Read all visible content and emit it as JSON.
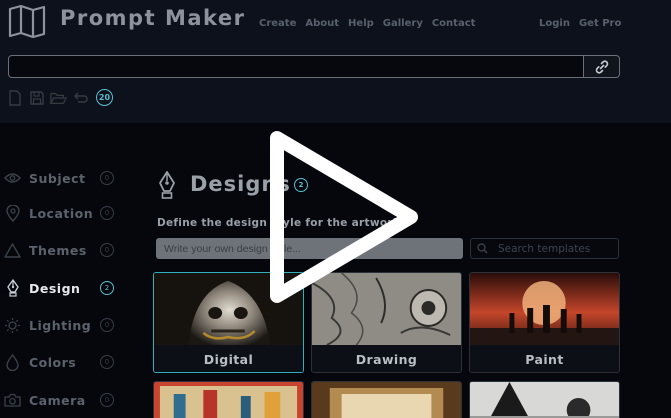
{
  "app": {
    "title": "Prompt Maker"
  },
  "nav": {
    "left": [
      "Create",
      "About",
      "Help",
      "Gallery",
      "Contact"
    ],
    "right": [
      "Login",
      "Get Pro"
    ]
  },
  "prompt": {
    "value": "",
    "placeholder": ""
  },
  "toolbar": {
    "icons": [
      "new-file-icon",
      "save-icon",
      "open-folder-icon",
      "undo-icon"
    ],
    "count": "20"
  },
  "sidebar": {
    "items": [
      {
        "label": "Subject",
        "badge": "0",
        "icon": "eye-icon",
        "active": false
      },
      {
        "label": "Location",
        "badge": "0",
        "icon": "location-pin-icon",
        "active": false
      },
      {
        "label": "Themes",
        "badge": "0",
        "icon": "warning-triangle-icon",
        "active": false
      },
      {
        "label": "Design",
        "badge": "2",
        "icon": "pen-nib-icon",
        "active": true
      },
      {
        "label": "Lighting",
        "badge": "0",
        "icon": "sun-icon",
        "active": false
      },
      {
        "label": "Colors",
        "badge": "0",
        "icon": "droplet-icon",
        "active": false
      },
      {
        "label": "Camera",
        "badge": "0",
        "icon": "camera-icon",
        "active": false
      }
    ]
  },
  "section": {
    "title": "Designs",
    "badge": "2",
    "description": "Define the design style for the artwork",
    "style_placeholder": "Write your own design style...",
    "search_placeholder": "Search templates"
  },
  "cards": [
    {
      "label": "Digital",
      "selected": true
    },
    {
      "label": "Drawing",
      "selected": false
    },
    {
      "label": "Paint",
      "selected": false
    },
    {
      "label": "",
      "selected": false
    },
    {
      "label": "",
      "selected": false
    },
    {
      "label": "",
      "selected": false
    }
  ],
  "colors": {
    "accent": "#5cbfd0",
    "background": "#05070d",
    "topbar": "#0d111b"
  }
}
